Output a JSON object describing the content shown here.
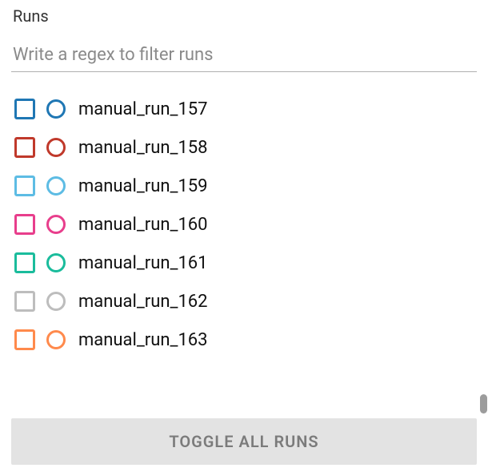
{
  "panel": {
    "title": "Runs"
  },
  "filter": {
    "placeholder": "Write a regex to filter runs",
    "value": ""
  },
  "runs": [
    {
      "label": "manual_run_157",
      "color": "#1f77b4"
    },
    {
      "label": "manual_run_158",
      "color": "#c0392b"
    },
    {
      "label": "manual_run_159",
      "color": "#5dbce4"
    },
    {
      "label": "manual_run_160",
      "color": "#e83e8c"
    },
    {
      "label": "manual_run_161",
      "color": "#1abc9c"
    },
    {
      "label": "manual_run_162",
      "color": "#bdbdbd"
    },
    {
      "label": "manual_run_163",
      "color": "#ff8a4c"
    }
  ],
  "toggle": {
    "label": "TOGGLE ALL RUNS"
  }
}
